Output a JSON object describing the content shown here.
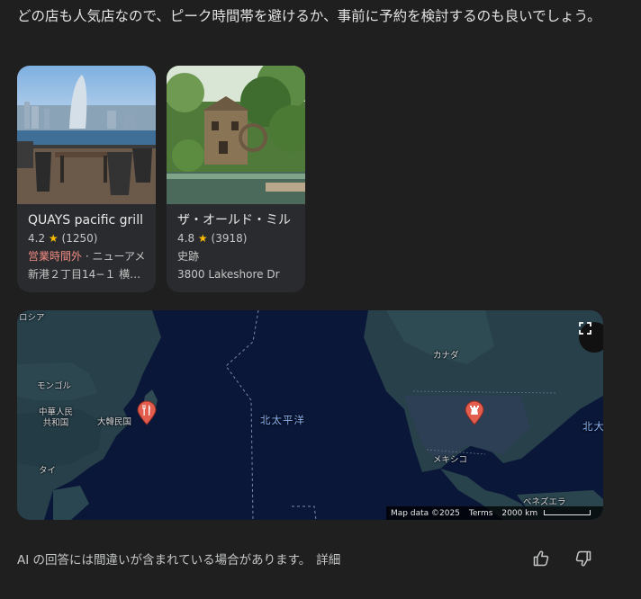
{
  "intro_text": "どの店も人気店なので、ピーク時間帯を避けるか、事前に予約を検討するのも良いでしょう。",
  "places": [
    {
      "name": "QUAYS pacific grill",
      "rating": "4.2",
      "reviews": "(1250)",
      "status": "営業時間外",
      "category": " · ニューアメ",
      "address": "新港２丁目14−１ 横…"
    },
    {
      "name": "ザ・オールド・ミル",
      "rating": "4.8",
      "reviews": "(3918)",
      "category": "史跡",
      "address": "3800 Lakeshore Dr"
    }
  ],
  "map": {
    "labels": {
      "russia": "ロシア",
      "mongolia": "モンゴル",
      "china": "中華人民\n共和国",
      "korea": "大韓民国",
      "thailand": "タイ",
      "pacific": "北太平洋",
      "pacific_right": "北大",
      "canada": "カナダ",
      "mexico": "メキシコ",
      "venezuela": "ベネズエラ"
    },
    "attribution": "Map data ©2025",
    "terms": "Terms",
    "scale": "2000 km",
    "pins": [
      {
        "icon": "restaurant-icon"
      },
      {
        "icon": "landmark-icon"
      }
    ]
  },
  "disclaimer": {
    "text": "AI の回答には間違いが含まれている場合があります。",
    "more": "詳細"
  },
  "colors": {
    "background": "#1f1f1f",
    "card": "#2a2b2e",
    "map_ocean": "#0a1739",
    "map_land": "#27404a",
    "pin": "#e35d4f",
    "closed_status": "#f28b82",
    "star": "#fbbc04"
  }
}
